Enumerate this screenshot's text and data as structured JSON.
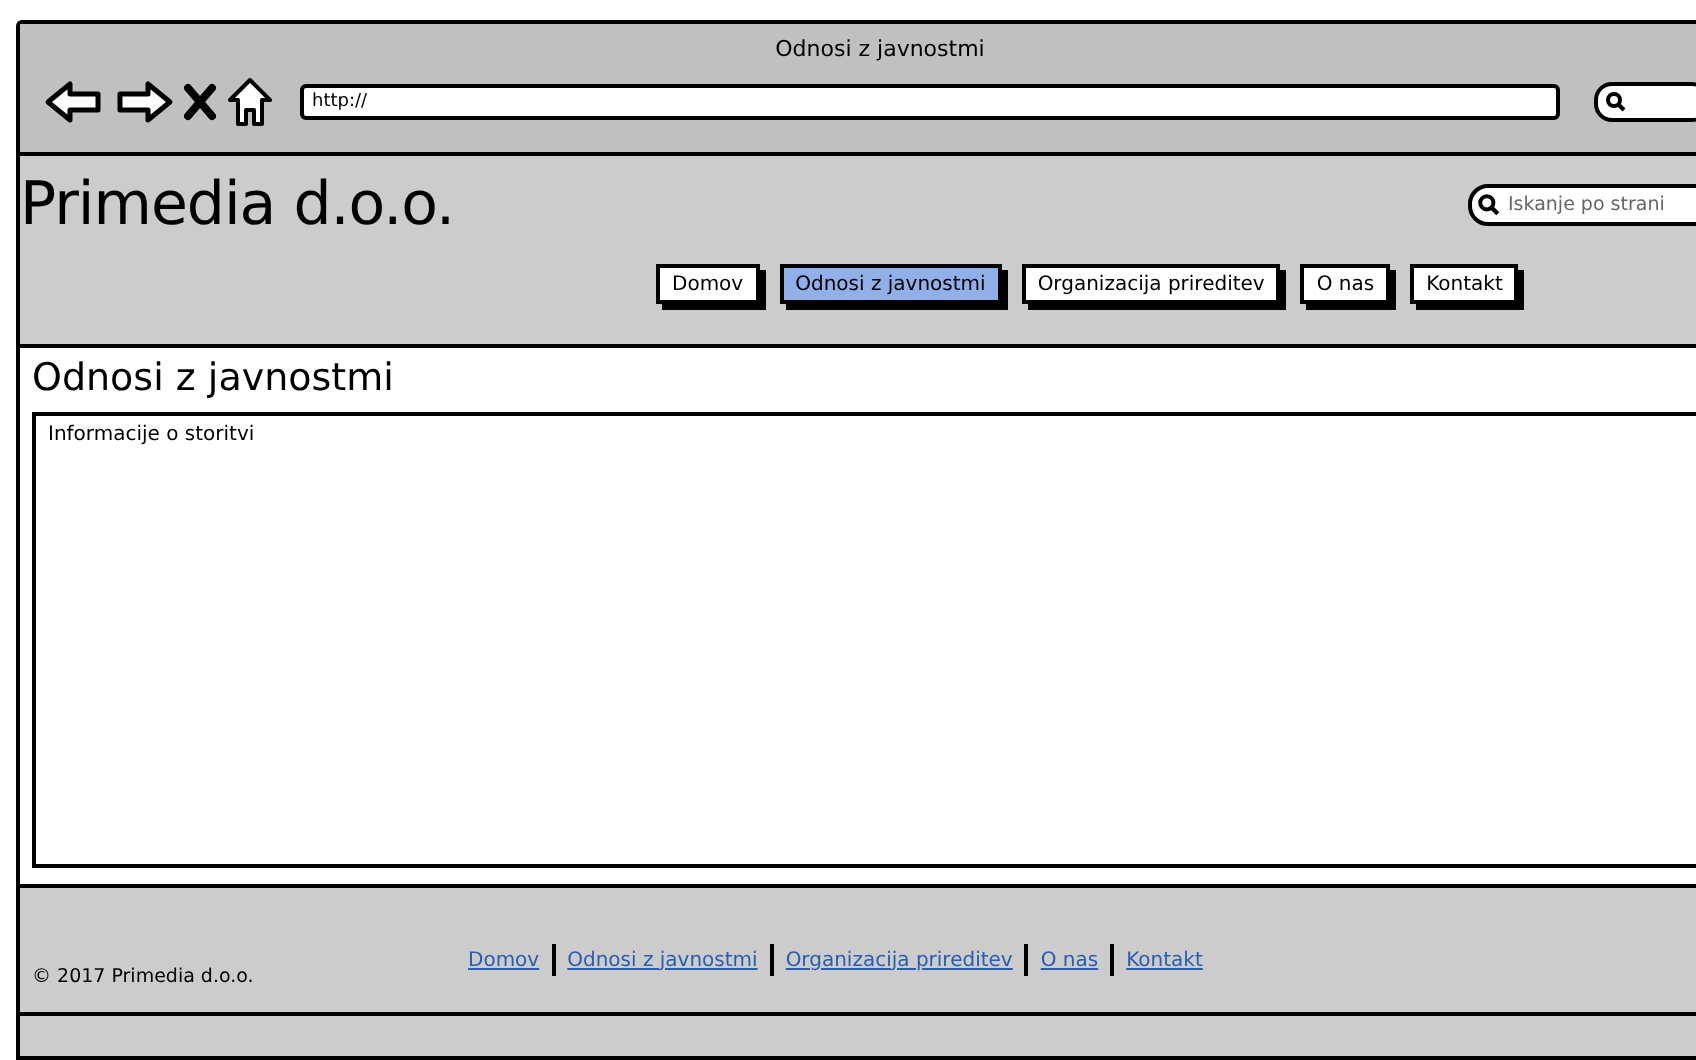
{
  "window": {
    "title": "Odnosi z javnostmi"
  },
  "toolbar": {
    "address": "http://"
  },
  "header": {
    "logo": "Primedia d.o.o.",
    "search": {
      "placeholder": "Iskanje po strani"
    }
  },
  "nav": [
    {
      "label": "Domov",
      "selected": false
    },
    {
      "label": "Odnosi z javnostmi",
      "selected": true
    },
    {
      "label": "Organizacija prireditev",
      "selected": false
    },
    {
      "label": "O nas",
      "selected": false
    },
    {
      "label": "Kontakt",
      "selected": false
    }
  ],
  "page": {
    "title": "Odnosi z javnostmi",
    "text": "Informacije o storitvi"
  },
  "footer": {
    "copyright": "© 2017 Primedia d.o.o.",
    "links": [
      "Domov",
      "Odnosi z javnostmi",
      "Organizacija prireditev",
      "O nas",
      "Kontakt"
    ]
  }
}
